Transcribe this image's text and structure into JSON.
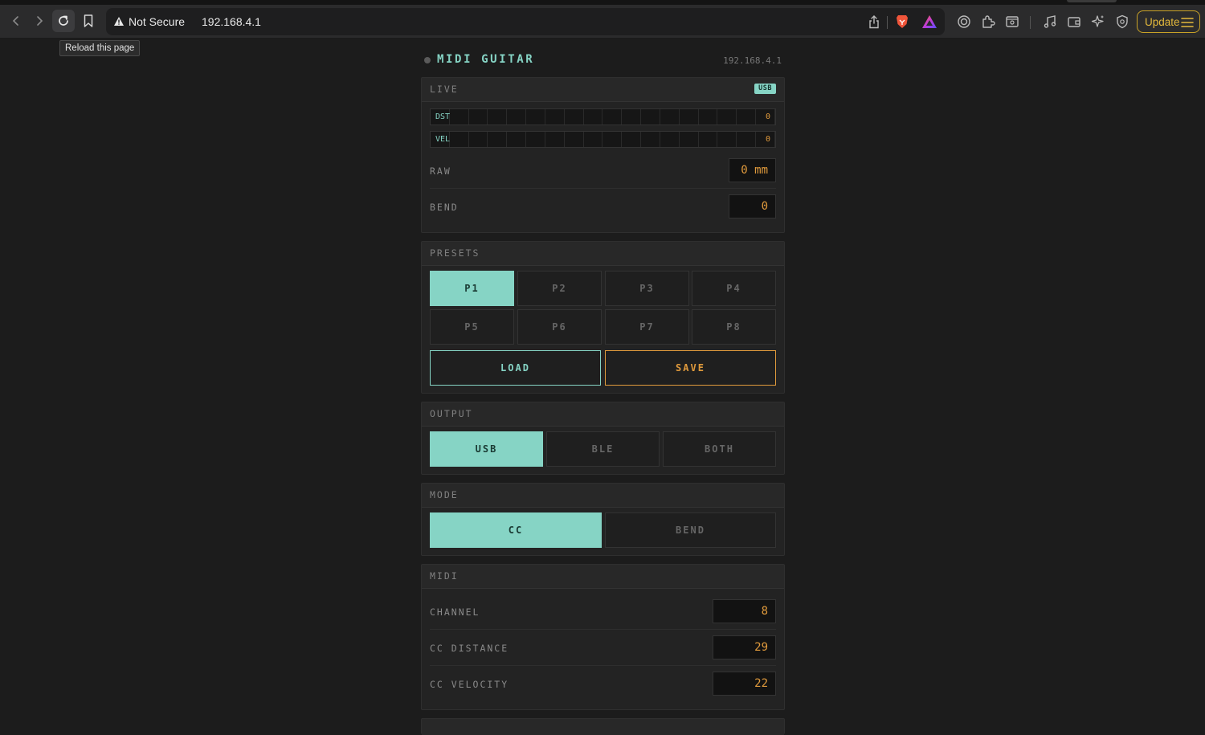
{
  "browser": {
    "security_label": "Not Secure",
    "url": "192.168.4.1",
    "update_label": "Update",
    "tooltip": "Reload this page"
  },
  "app": {
    "title": "MIDI GUITAR",
    "ip": "192.168.4.1"
  },
  "live": {
    "title": "LIVE",
    "badge": "USB",
    "dst_label": "DST",
    "dst_value": "0",
    "vel_label": "VEL",
    "vel_value": "0",
    "raw_label": "RAW",
    "raw_value": "0 mm",
    "bend_label": "BEND",
    "bend_value": "0"
  },
  "presets": {
    "title": "PRESETS",
    "items": [
      "P1",
      "P2",
      "P3",
      "P4",
      "P5",
      "P6",
      "P7",
      "P8"
    ],
    "selected": "P1",
    "load_label": "LOAD",
    "save_label": "SAVE"
  },
  "output": {
    "title": "OUTPUT",
    "options": [
      "USB",
      "BLE",
      "BOTH"
    ],
    "selected": "USB"
  },
  "mode": {
    "title": "MODE",
    "options": [
      "CC",
      "BEND"
    ],
    "selected": "CC"
  },
  "midi": {
    "title": "MIDI",
    "channel_label": "CHANNEL",
    "channel_value": "8",
    "cc_distance_label": "CC DISTANCE",
    "cc_distance_value": "29",
    "cc_velocity_label": "CC VELOCITY",
    "cc_velocity_value": "22"
  },
  "colors": {
    "accent": "#86d4c5",
    "value": "#e09a3c",
    "background": "#1c1c1c"
  }
}
